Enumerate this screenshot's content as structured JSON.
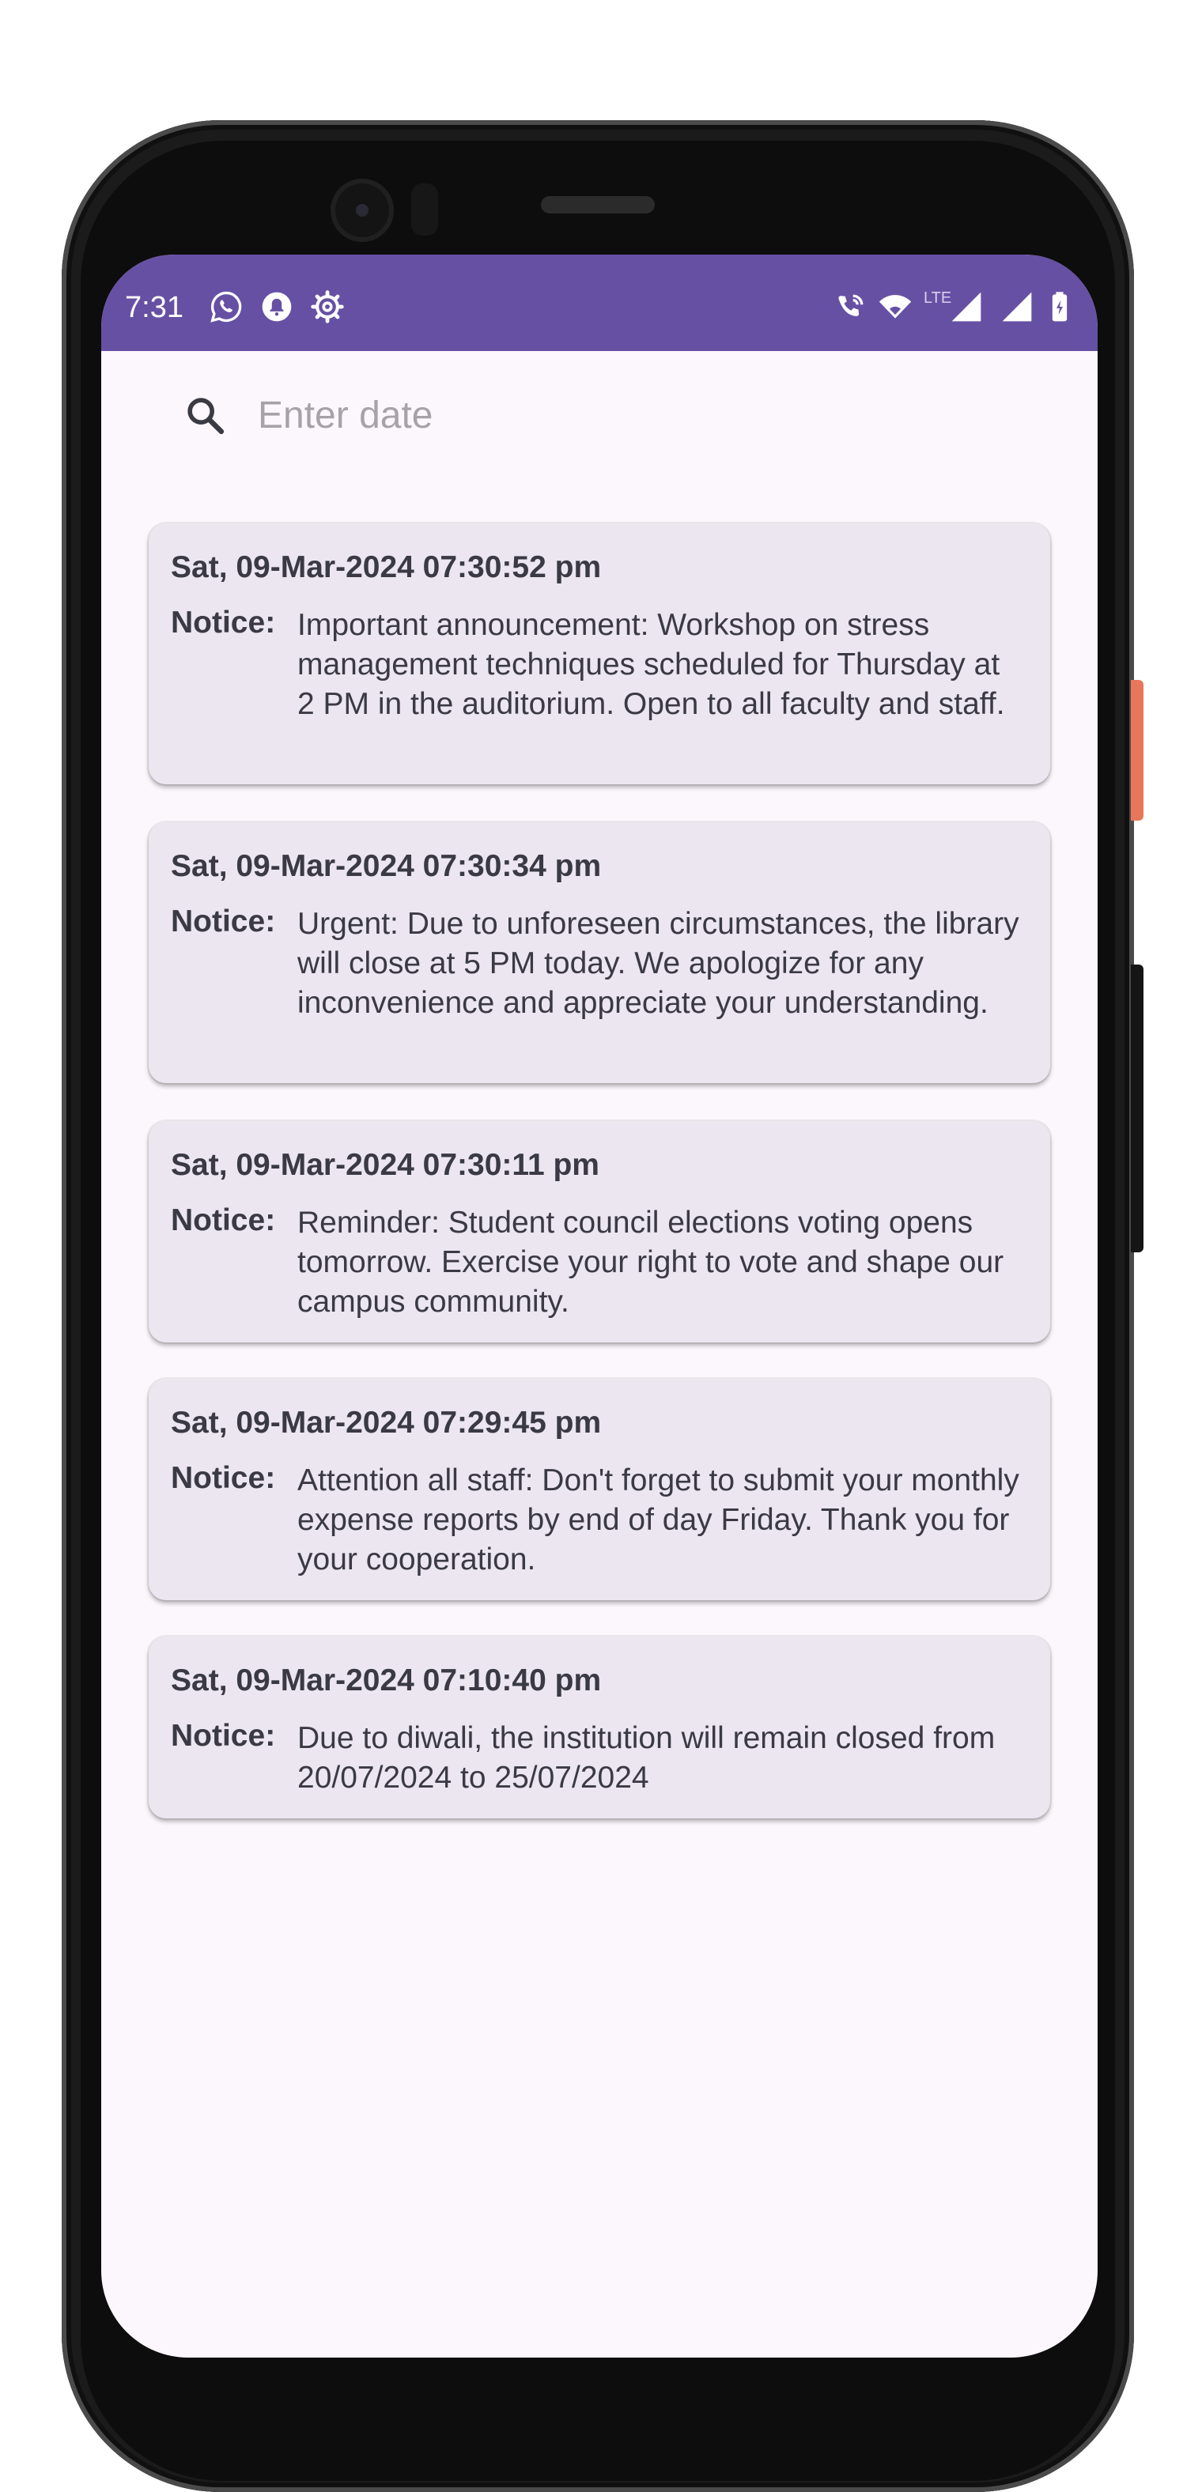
{
  "status_bar": {
    "time": "7:31",
    "left_icons": [
      "whatsapp-icon",
      "notification-bell-icon",
      "settings-gear-icon"
    ],
    "right_icons": [
      "wifi-calling-icon",
      "wifi-icon",
      "lte-icon",
      "signal-icon",
      "signal-icon",
      "battery-charging-icon"
    ],
    "network_label": "LTE",
    "color": "#6650a4"
  },
  "search": {
    "placeholder": "Enter date",
    "value": ""
  },
  "notices": [
    {
      "date": "Sat, 09-Mar-2024 07:30:52 pm",
      "label": "Notice:",
      "text": "Important announcement: Workshop on stress management techniques scheduled for Thursday at 2 PM in the auditorium. Open to all faculty and staff."
    },
    {
      "date": "Sat, 09-Mar-2024 07:30:34 pm",
      "label": "Notice:",
      "text": "Urgent: Due to unforeseen circumstances, the library will close at 5 PM today. We apologize for any inconvenience and appreciate your understanding."
    },
    {
      "date": "Sat, 09-Mar-2024 07:30:11 pm",
      "label": "Notice:",
      "text": "Reminder: Student council elections voting opens tomorrow. Exercise your right to vote and shape our campus community."
    },
    {
      "date": "Sat, 09-Mar-2024 07:29:45 pm",
      "label": "Notice:",
      "text": "Attention all staff: Don't forget to submit your monthly expense reports by end of day Friday. Thank you for your cooperation."
    },
    {
      "date": "Sat, 09-Mar-2024 07:10:40 pm",
      "label": "Notice:",
      "text": "Due to diwali, the institution will remain closed from 20/07/2024 to 25/07/2024"
    }
  ],
  "colors": {
    "card_background": "#ece6f0",
    "screen_background": "#fcf7fc",
    "text": "#3a3a44"
  }
}
